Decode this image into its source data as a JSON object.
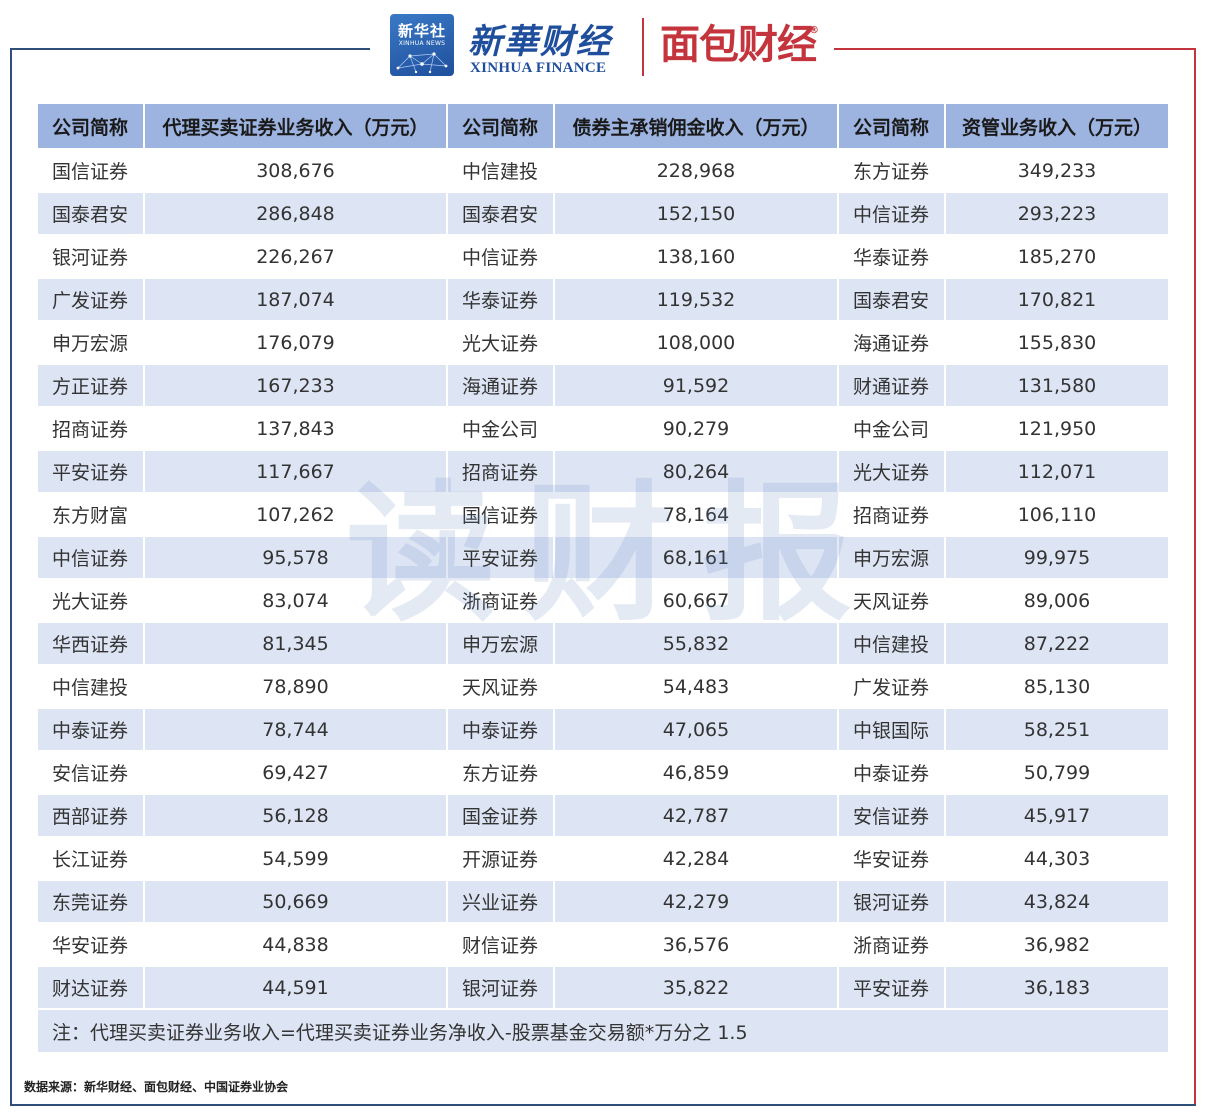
{
  "header": {
    "xinhua_badge_cn": "新华社",
    "xinhua_badge_en": "XINHUA NEWS",
    "finance_logo_cn": "新華财经",
    "finance_logo_en": "XINHUA FINANCE",
    "mianbao_logo": "面包财经",
    "mianbao_reg": "®"
  },
  "watermark": "读财报",
  "colors": {
    "left_frame": "#2f4f7a",
    "right_frame": "#c4343c",
    "header_row": "#9db3e0",
    "stripe_row": "#dde5f4",
    "brand_blue": "#1f4f9c",
    "brand_red": "#c4343c"
  },
  "table": {
    "headers": [
      "公司简称",
      "代理买卖证券业务收入（万元）",
      "公司简称",
      "债券主承销佣金收入（万元）",
      "公司简称",
      "资管业务收入（万元）"
    ],
    "rows": [
      [
        "国信证券",
        "308,676",
        "中信建投",
        "228,968",
        "东方证券",
        "349,233"
      ],
      [
        "国泰君安",
        "286,848",
        "国泰君安",
        "152,150",
        "中信证券",
        "293,223"
      ],
      [
        "银河证券",
        "226,267",
        "中信证券",
        "138,160",
        "华泰证券",
        "185,270"
      ],
      [
        "广发证券",
        "187,074",
        "华泰证券",
        "119,532",
        "国泰君安",
        "170,821"
      ],
      [
        "申万宏源",
        "176,079",
        "光大证券",
        "108,000",
        "海通证券",
        "155,830"
      ],
      [
        "方正证券",
        "167,233",
        "海通证券",
        "91,592",
        "财通证券",
        "131,580"
      ],
      [
        "招商证券",
        "137,843",
        "中金公司",
        "90,279",
        "中金公司",
        "121,950"
      ],
      [
        "平安证券",
        "117,667",
        "招商证券",
        "80,264",
        "光大证券",
        "112,071"
      ],
      [
        "东方财富",
        "107,262",
        "国信证券",
        "78,164",
        "招商证券",
        "106,110"
      ],
      [
        "中信证券",
        "95,578",
        "平安证券",
        "68,161",
        "申万宏源",
        "99,975"
      ],
      [
        "光大证券",
        "83,074",
        "浙商证券",
        "60,667",
        "天风证券",
        "89,006"
      ],
      [
        "华西证券",
        "81,345",
        "申万宏源",
        "55,832",
        "中信建投",
        "87,222"
      ],
      [
        "中信建投",
        "78,890",
        "天风证券",
        "54,483",
        "广发证券",
        "85,130"
      ],
      [
        "中泰证券",
        "78,744",
        "中泰证券",
        "47,065",
        "中银国际",
        "58,251"
      ],
      [
        "安信证券",
        "69,427",
        "东方证券",
        "46,859",
        "中泰证券",
        "50,799"
      ],
      [
        "西部证券",
        "56,128",
        "国金证券",
        "42,787",
        "安信证券",
        "45,917"
      ],
      [
        "长江证券",
        "54,599",
        "开源证券",
        "42,284",
        "华安证券",
        "44,303"
      ],
      [
        "东莞证券",
        "50,669",
        "兴业证券",
        "42,279",
        "银河证券",
        "43,824"
      ],
      [
        "华安证券",
        "44,838",
        "财信证券",
        "36,576",
        "浙商证券",
        "36,982"
      ],
      [
        "财达证券",
        "44,591",
        "银河证券",
        "35,822",
        "平安证券",
        "36,183"
      ]
    ],
    "note": "注：代理买卖证券业务收入=代理买卖证券业务净收入-股票基金交易额*万分之 1.5"
  },
  "source": "数据来源：新华财经、面包财经、中国证券业协会"
}
